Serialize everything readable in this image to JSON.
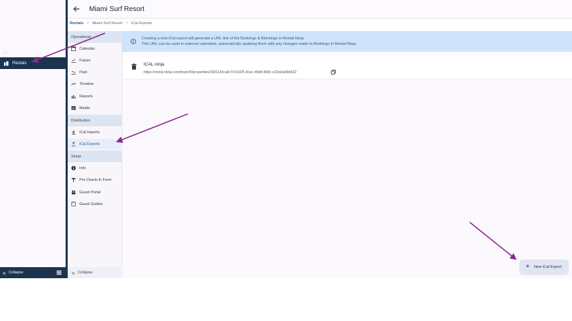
{
  "nav": {
    "rentals_label": "Rentals",
    "collapse_label": "Collapse"
  },
  "header": {
    "title": "Miami Surf Resort"
  },
  "breadcrumb": {
    "items": [
      "Rentals",
      "Miami Surf Resort",
      "iCal Exports"
    ]
  },
  "subnav": {
    "sections": [
      {
        "title": "Operational"
      },
      {
        "title": "Distribution"
      },
      {
        "title": "Setup"
      }
    ],
    "items": [
      {
        "label": "Calendar"
      },
      {
        "label": "Future"
      },
      {
        "label": "Past"
      },
      {
        "label": "Timeline"
      },
      {
        "label": "Reports"
      },
      {
        "label": "Media"
      },
      {
        "label": "iCal Imports"
      },
      {
        "label": "iCal Exports"
      },
      {
        "label": "Info"
      },
      {
        "label": "Pre Check-In Form"
      },
      {
        "label": "Guest Portal"
      },
      {
        "label": "Guest Guides"
      }
    ],
    "collapse_label": "Collapse"
  },
  "banner": {
    "line1": "Creating a new iCal export will generate a URL link of the Bookings & Blockings in Rental Ninja.",
    "line2": "This URL can be used in external calendars, automatically updating them with any changes made to Bookings in Rental Ninja."
  },
  "export": {
    "name": "ICAL ninja",
    "url": "https://rental-ninja.com/team/5/properties/190114/ical/c7c01925-4cec-49d4-968c-e23a0ab5b822"
  },
  "actions": {
    "new_export_label": "New iCal Export"
  },
  "colors": {
    "nav_dark": "#1c3350",
    "accent": "#2f5b8f",
    "banner_bg": "#cfe3fa",
    "arrow": "#8a2a8e"
  }
}
